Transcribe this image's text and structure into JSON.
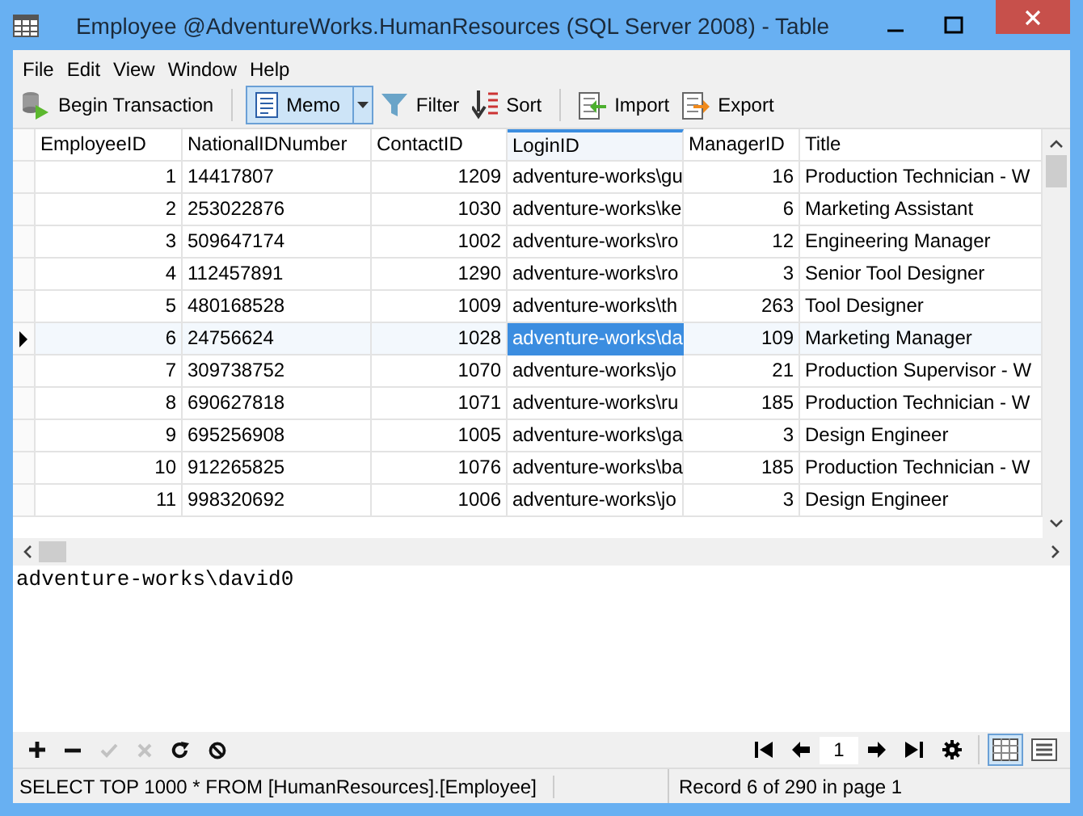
{
  "window": {
    "title": "Employee @AdventureWorks.HumanResources (SQL Server 2008) - Table"
  },
  "menu": [
    "File",
    "Edit",
    "View",
    "Window",
    "Help"
  ],
  "toolbar": {
    "begin_transaction": "Begin Transaction",
    "memo": {
      "label": "Memo",
      "selected": true
    },
    "filter": "Filter",
    "sort": "Sort",
    "import": "Import",
    "export": "Export"
  },
  "grid": {
    "columns": [
      {
        "label": "EmployeeID",
        "kind": "number",
        "selected": false
      },
      {
        "label": "NationalIDNumber",
        "kind": "text",
        "selected": false
      },
      {
        "label": "ContactID",
        "kind": "number",
        "selected": false
      },
      {
        "label": "LoginID",
        "kind": "text",
        "selected": true
      },
      {
        "label": "ManagerID",
        "kind": "number",
        "selected": false
      },
      {
        "label": "Title",
        "kind": "text",
        "selected": false
      }
    ],
    "rows": [
      {
        "selected": false,
        "cells": [
          "1",
          "14417807",
          "1209",
          "adventure-works\\gu",
          "16",
          "Production Technician - W"
        ]
      },
      {
        "selected": false,
        "cells": [
          "2",
          "253022876",
          "1030",
          "adventure-works\\ke",
          "6",
          "Marketing Assistant"
        ]
      },
      {
        "selected": false,
        "cells": [
          "3",
          "509647174",
          "1002",
          "adventure-works\\ro",
          "12",
          "Engineering Manager"
        ]
      },
      {
        "selected": false,
        "cells": [
          "4",
          "112457891",
          "1290",
          "adventure-works\\ro",
          "3",
          "Senior Tool Designer"
        ]
      },
      {
        "selected": false,
        "cells": [
          "5",
          "480168528",
          "1009",
          "adventure-works\\th",
          "263",
          "Tool Designer"
        ]
      },
      {
        "selected": true,
        "cells": [
          "6",
          "24756624",
          "1028",
          "adventure-works\\da",
          "109",
          "Marketing Manager"
        ]
      },
      {
        "selected": false,
        "cells": [
          "7",
          "309738752",
          "1070",
          "adventure-works\\jo",
          "21",
          "Production Supervisor - W"
        ]
      },
      {
        "selected": false,
        "cells": [
          "8",
          "690627818",
          "1071",
          "adventure-works\\ru",
          "185",
          "Production Technician - W"
        ]
      },
      {
        "selected": false,
        "cells": [
          "9",
          "695256908",
          "1005",
          "adventure-works\\ga",
          "3",
          "Design Engineer"
        ]
      },
      {
        "selected": false,
        "cells": [
          "10",
          "912265825",
          "1076",
          "adventure-works\\ba",
          "185",
          "Production Technician - W"
        ]
      },
      {
        "selected": false,
        "cells": [
          "11",
          "998320692",
          "1006",
          "adventure-works\\jo",
          "3",
          "Design Engineer"
        ]
      }
    ]
  },
  "memo": {
    "value": "adventure-works\\david0"
  },
  "actions": [
    {
      "kind": "add",
      "disabled": false
    },
    {
      "kind": "delete",
      "disabled": false
    },
    {
      "kind": "apply",
      "disabled": true
    },
    {
      "kind": "cancel",
      "disabled": true
    },
    {
      "kind": "refresh",
      "disabled": false
    },
    {
      "kind": "stop",
      "disabled": false
    }
  ],
  "navigator": {
    "page": "1"
  },
  "views": [
    {
      "kind": "grid",
      "selected": true
    },
    {
      "kind": "form",
      "selected": false
    }
  ],
  "status_bar": {
    "query": "SELECT TOP 1000  * FROM [HumanResources].[Employee]",
    "record": "Record 6 of 290 in page 1"
  }
}
